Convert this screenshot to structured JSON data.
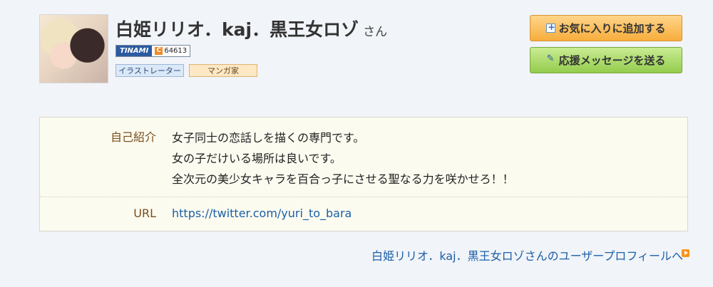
{
  "user": {
    "name": "白姫リリオ．kaj．黒王女ロゾ",
    "honorific": "さん"
  },
  "badge": {
    "service": "TINAMI",
    "count_icon": "C",
    "count": "64613"
  },
  "tags": [
    "イラストレーター",
    "マンガ家"
  ],
  "buttons": {
    "favorite": "お気に入りに追加する",
    "message": "応援メッセージを送る"
  },
  "profile": {
    "intro_label": "自己紹介",
    "intro_lines": [
      "女子同士の恋話しを描くの専門です。",
      "女の子だけいる場所は良いです。",
      "全次元の美少女キャラを百合っ子にさせる聖なる力を咲かせろ！！"
    ],
    "url_label": "URL",
    "url": "https://twitter.com/yuri_to_bara"
  },
  "footer_link": "白姫リリオ．kaj．黒王女ロゾさんのユーザープロフィールへ",
  "colors": {
    "page_bg": "#f1f4f8",
    "link": "#1a5fa8",
    "label": "#7a4e1c",
    "favorite_button": "#f7ad3c",
    "message_button": "#94cc4d"
  }
}
